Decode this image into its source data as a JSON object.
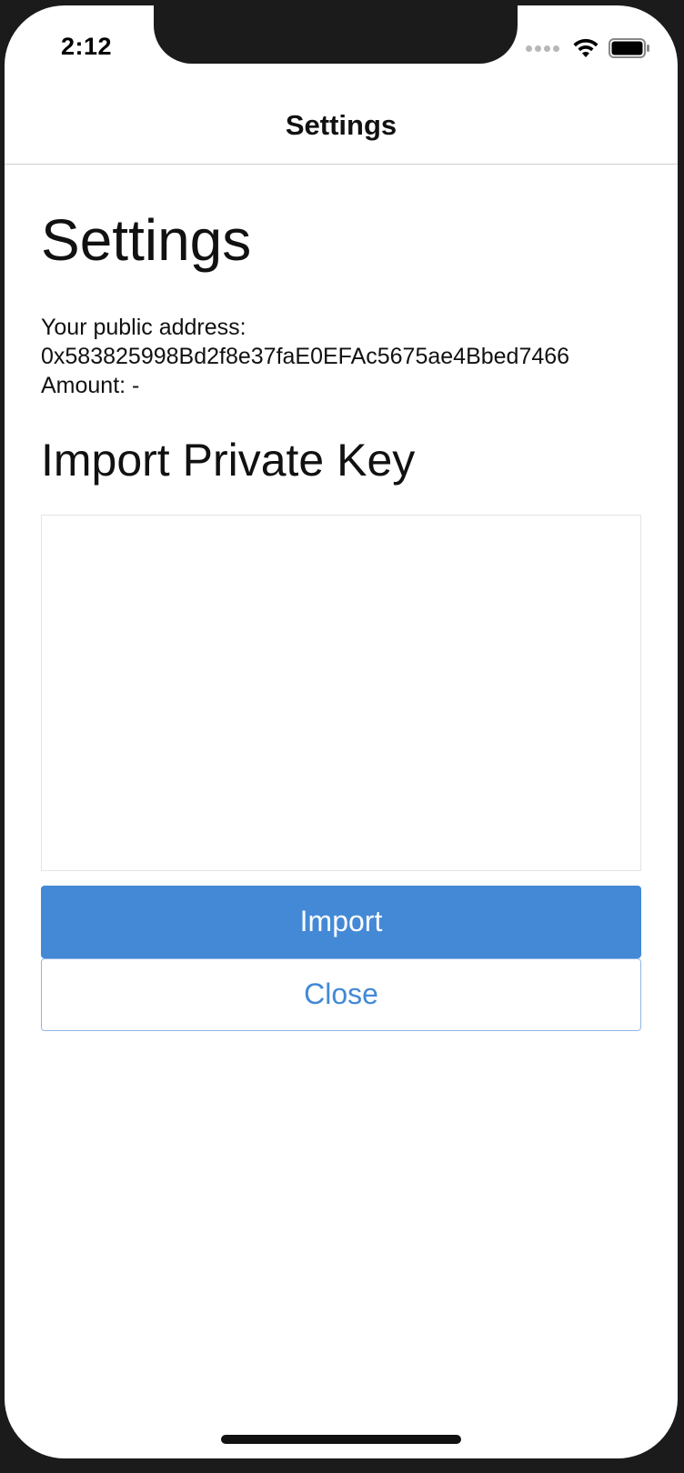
{
  "status_bar": {
    "time": "2:12"
  },
  "nav": {
    "title": "Settings"
  },
  "page": {
    "title": "Settings",
    "address_label": "Your public address:",
    "address_value": "0x583825998Bd2f8e37faE0EFAc5675ae4Bbed7466",
    "amount_label": "Amount: -",
    "import_title": "Import Private Key",
    "private_key_input": {
      "value": "",
      "placeholder": ""
    },
    "import_button": "Import",
    "close_button": "Close"
  },
  "colors": {
    "accent": "#4389d6",
    "frame": "#1b1b1b",
    "background": "#ffffff"
  }
}
